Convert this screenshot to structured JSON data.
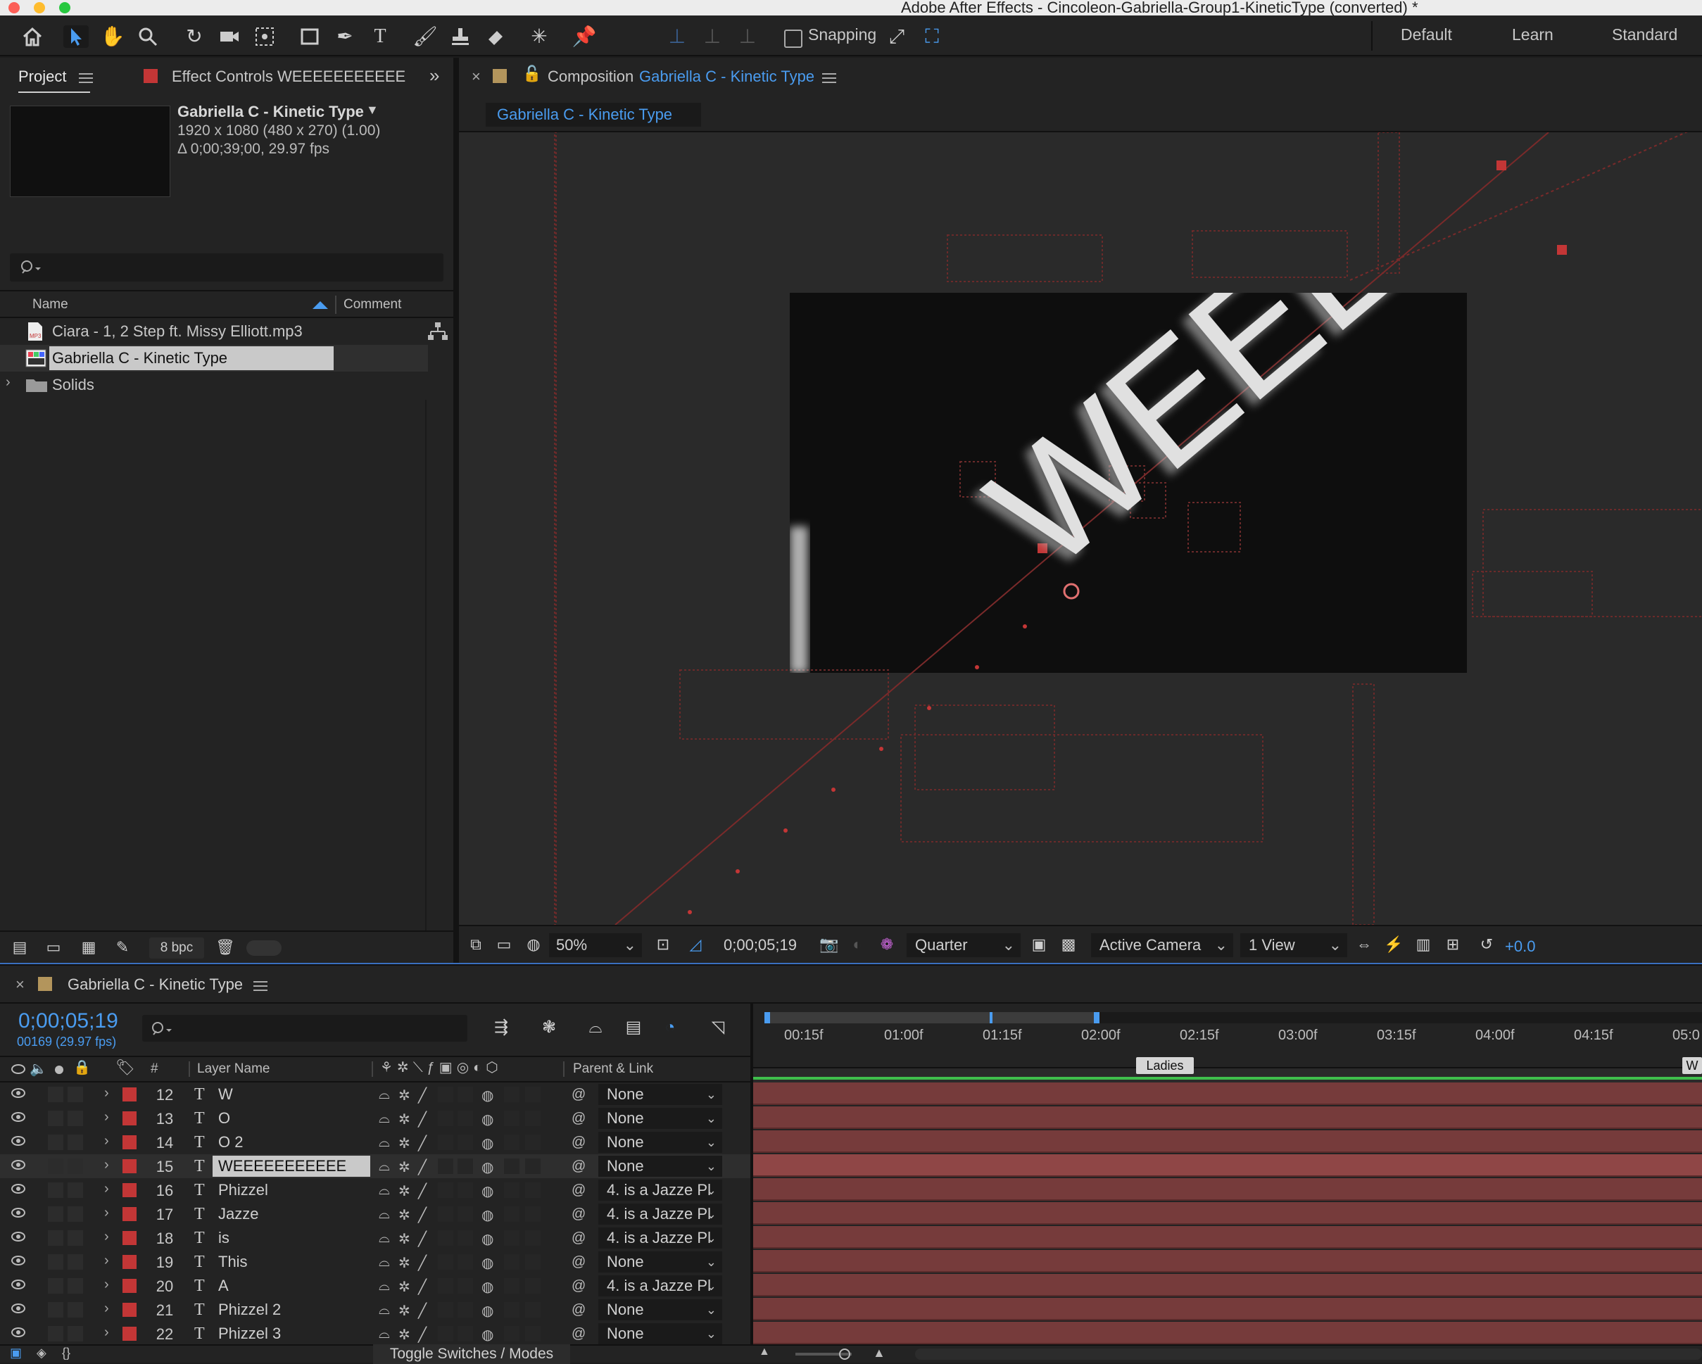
{
  "window": {
    "title": "Adobe After Effects - Cincoleon-Gabriella-Group1-KineticType (converted) *"
  },
  "toolbar": {
    "snapping_label": "Snapping",
    "workspaces": [
      "Default",
      "Learn",
      "Standard"
    ]
  },
  "project_panel": {
    "tab_project": "Project",
    "tab_effect_controls": "Effect Controls WEEEEEEEEEEE",
    "item_name": "Gabriella C - Kinetic Type",
    "item_dimensions": "1920 x 1080  (480 x 270) (1.00)",
    "item_duration": "Δ 0;00;39;00, 29.97 fps",
    "col_name": "Name",
    "col_comment": "Comment",
    "items": [
      {
        "name": "Ciara - 1, 2 Step ft. Missy Elliott.mp3",
        "icon": "audio-file-icon"
      },
      {
        "name": "Gabriella C - Kinetic Type",
        "icon": "composition-icon"
      },
      {
        "name": "Solids",
        "icon": "folder-icon"
      }
    ],
    "bpc": "8 bpc"
  },
  "composition_panel": {
    "tab_prefix": "Composition",
    "tab_name": "Gabriella C - Kinetic Type",
    "breadcrumb": "Gabriella C - Kinetic Type",
    "viewer_text": "WEEEL",
    "zoom": "50%",
    "timecode": "0;00;05;19",
    "resolution": "Quarter",
    "camera": "Active Camera",
    "views": "1 View",
    "exposure": "+0.0"
  },
  "timeline": {
    "tab_name": "Gabriella C - Kinetic Type",
    "timecode": "0;00;05;19",
    "frame_info": "00169 (29.97 fps)",
    "col_number": "#",
    "col_layer_name": "Layer Name",
    "col_parent": "Parent & Link",
    "ruler": [
      "00:15f",
      "01:00f",
      "01:15f",
      "02:00f",
      "02:15f",
      "03:00f",
      "03:15f",
      "04:00f",
      "04:15f",
      "05:0"
    ],
    "marker": "Ladies",
    "marker_end": "W",
    "layers": [
      {
        "num": "12",
        "name": "W",
        "parent": "None"
      },
      {
        "num": "13",
        "name": "O",
        "parent": "None"
      },
      {
        "num": "14",
        "name": "O 2",
        "parent": "None"
      },
      {
        "num": "15",
        "name": "WEEEEEEEEEEE",
        "parent": "None",
        "selected": true
      },
      {
        "num": "16",
        "name": "Phizzel",
        "parent": "4. is a Jazze Pl"
      },
      {
        "num": "17",
        "name": "Jazze",
        "parent": "4. is a Jazze Pl"
      },
      {
        "num": "18",
        "name": "is",
        "parent": "4. is a Jazze Pl"
      },
      {
        "num": "19",
        "name": "This",
        "parent": "None"
      },
      {
        "num": "20",
        "name": "A",
        "parent": "4. is a Jazze Pl"
      },
      {
        "num": "21",
        "name": "Phizzel 2",
        "parent": "None"
      },
      {
        "num": "22",
        "name": "Phizzel 3",
        "parent": "None"
      }
    ],
    "toggle_label": "Toggle Switches / Modes"
  },
  "colors": {
    "accent": "#4a9cf0",
    "label_red": "#c33636",
    "layer_bar": "#763b3b"
  }
}
